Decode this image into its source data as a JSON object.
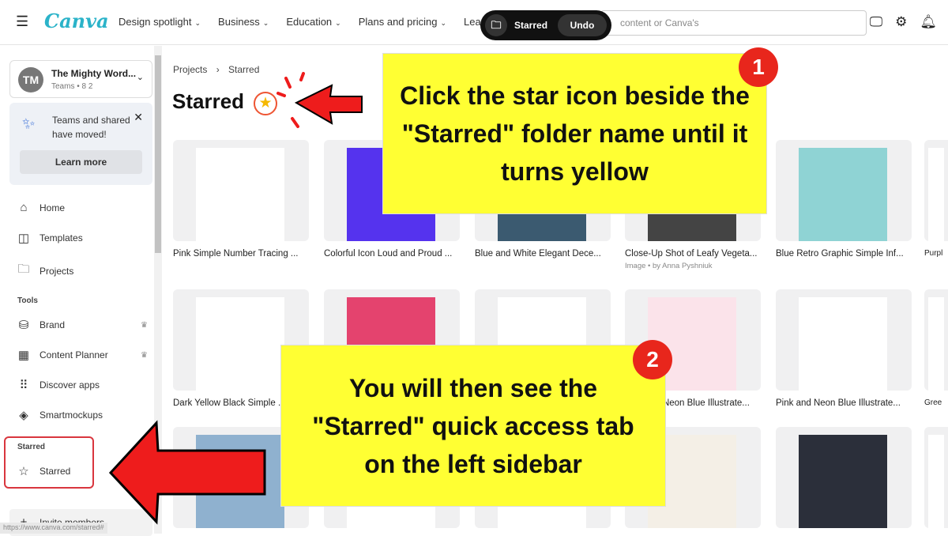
{
  "header": {
    "brand": "Canva",
    "nav": [
      "Design spotlight",
      "Business",
      "Education",
      "Plans and pricing",
      "Learn"
    ],
    "search_placeholder": "content or Canva's"
  },
  "toast": {
    "label": "Starred",
    "undo": "Undo"
  },
  "sidebar": {
    "team": {
      "initials": "TM",
      "name": "The Mighty Word...",
      "meta": "Teams • 8 2"
    },
    "notice": {
      "text": "Teams and shared have moved!",
      "button": "Learn more"
    },
    "items": [
      {
        "label": "Home",
        "icon": "home-icon"
      },
      {
        "label": "Templates",
        "icon": "templates-icon"
      },
      {
        "label": "Projects",
        "icon": "folder-icon"
      }
    ],
    "tools_heading": "Tools",
    "tools": [
      {
        "label": "Brand",
        "icon": "brand-icon",
        "crown": true
      },
      {
        "label": "Content Planner",
        "icon": "calendar-icon",
        "crown": true
      },
      {
        "label": "Discover apps",
        "icon": "apps-icon"
      },
      {
        "label": "Smartmockups",
        "icon": "mockup-icon"
      }
    ],
    "starred_heading": "Starred",
    "starred_item": "Starred",
    "invite": "Invite members",
    "status_url": "https://www.canva.com/starred#"
  },
  "main": {
    "breadcrumb": [
      "Projects",
      "Starred"
    ],
    "title": "Starred",
    "star_color": "#f5b800",
    "rows": [
      [
        {
          "caption": "Pink Simple Number Tracing ...",
          "thumb": "#ffffff"
        },
        {
          "caption": "Colorful Icon Loud and Proud ...",
          "thumb": "#5533ee"
        },
        {
          "caption": "Blue and White Elegant Dece...",
          "thumb": "#3b5a70"
        },
        {
          "caption": "Close-Up Shot of Leafy Vegeta...",
          "sub": "Image • by Anna Pyshniuk",
          "thumb": "#444444"
        },
        {
          "caption": "Blue Retro Graphic Simple Inf...",
          "thumb": "#8fd3d4"
        },
        {
          "caption": "Purpl",
          "thumb": "#ffffff"
        }
      ],
      [
        {
          "caption": "Dark Yellow Black Simple ...",
          "thumb": "#ffffff"
        },
        {
          "caption": "",
          "thumb": "#e4436e"
        },
        {
          "caption": "",
          "thumb": "#ffffff"
        },
        {
          "caption": "Pink and Neon Blue Illustrate...",
          "thumb": "#fbe3ea"
        },
        {
          "caption": "Pink and Neon Blue Illustrate...",
          "thumb": "#ffffff"
        },
        {
          "caption": "Gree",
          "thumb": "#ffffff"
        }
      ],
      [
        {
          "caption": "",
          "thumb": "#8fb1cf"
        },
        {
          "caption": "",
          "thumb": "#ffffff"
        },
        {
          "caption": "",
          "thumb": "#ffffff"
        },
        {
          "caption": "",
          "thumb": "#f4efe6"
        },
        {
          "caption": "",
          "thumb": "#2b2f3a"
        },
        {
          "caption": "",
          "thumb": "#ffffff"
        }
      ]
    ]
  },
  "callouts": [
    {
      "number": "1",
      "text": "Click the star icon beside the \"Starred\" folder name until it turns yellow"
    },
    {
      "number": "2",
      "text": "You will then see the \"Starred\" quick access tab on the left sidebar"
    }
  ],
  "colors": {
    "callout": "#ffff33",
    "badge": "#e8261c",
    "arrow": "#ee1c1c"
  }
}
